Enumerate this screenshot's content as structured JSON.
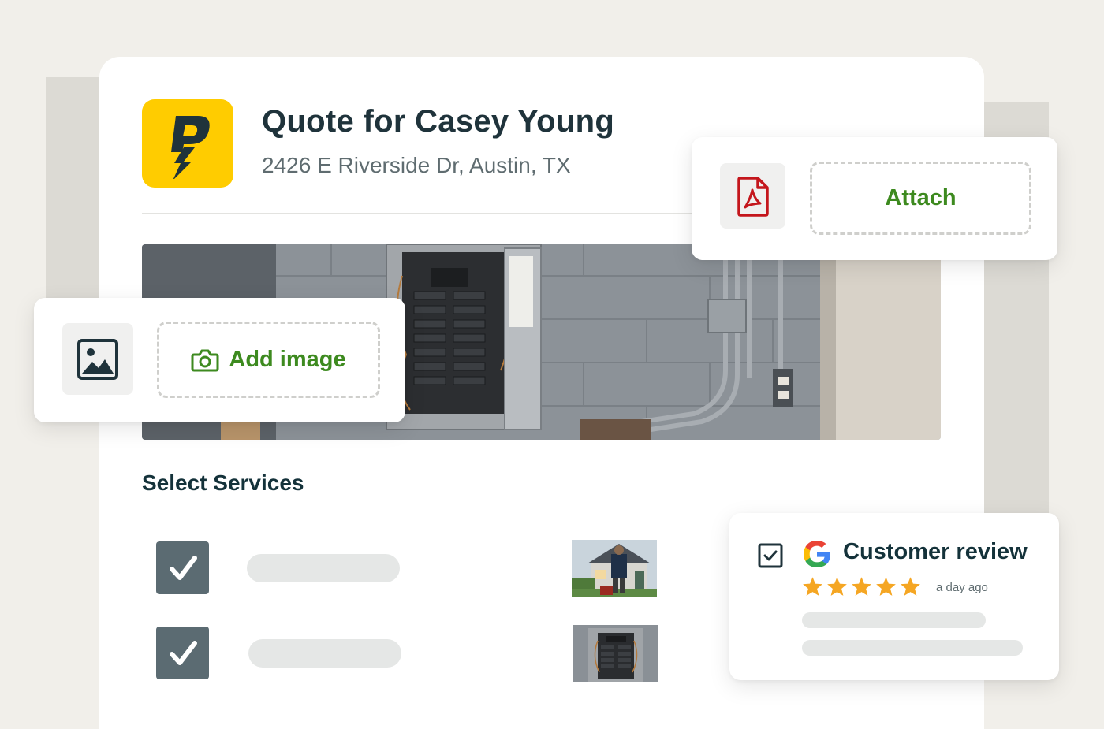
{
  "quote": {
    "title": "Quote for Casey Young",
    "address": "2426 E Riverside Dr, Austin, TX"
  },
  "actions": {
    "attach_label": "Attach",
    "add_image_label": "Add image"
  },
  "services": {
    "section_title": "Select Services",
    "items": [
      {
        "checked": true
      },
      {
        "checked": true
      }
    ]
  },
  "review": {
    "title": "Customer review",
    "time": "a day ago",
    "rating": 5
  },
  "colors": {
    "brand_yellow": "#ffcc00",
    "brand_navy": "#14323a",
    "accent_green": "#3d8a1f",
    "pdf_red": "#c4161c",
    "star": "#f5a623"
  },
  "icons": {
    "logo": "lightning-p-logo",
    "image": "image-icon",
    "camera": "camera-icon",
    "pdf": "pdf-icon",
    "google": "google-icon",
    "checkbox": "checkbox-checked-icon"
  }
}
